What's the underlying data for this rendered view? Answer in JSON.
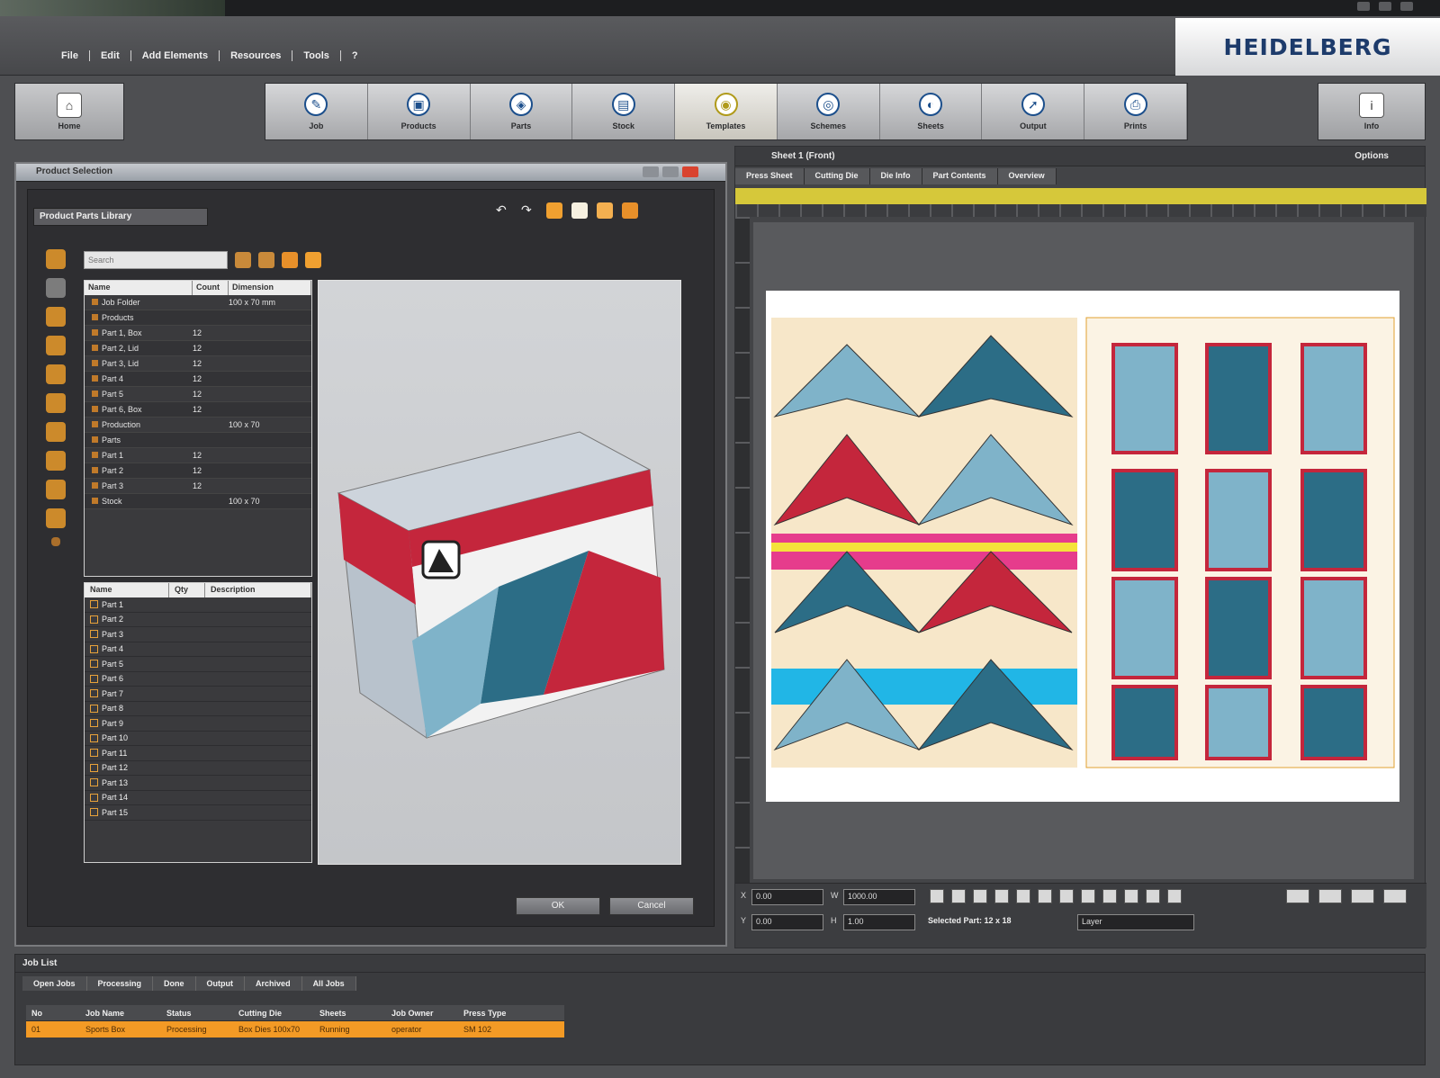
{
  "brand": {
    "logo_text": "HEIDELBERG"
  },
  "menu": {
    "items": [
      "File",
      "Edit",
      "Add Elements",
      "Resources",
      "Tools",
      "?"
    ]
  },
  "toolbar": {
    "home_label": "Home",
    "right_label": "Info",
    "steps": [
      {
        "label": "Job",
        "icon": "job-icon"
      },
      {
        "label": "Products",
        "icon": "products-icon"
      },
      {
        "label": "Parts",
        "icon": "parts-icon"
      },
      {
        "label": "Stock",
        "icon": "stock-icon"
      },
      {
        "label": "Templates",
        "icon": "templates-icon"
      },
      {
        "label": "Schemes",
        "icon": "schemes-icon"
      },
      {
        "label": "Sheets",
        "icon": "sheets-icon"
      },
      {
        "label": "Output",
        "icon": "output-icon"
      },
      {
        "label": "Prints",
        "icon": "prints-icon"
      }
    ]
  },
  "dialog": {
    "title": "Product Selection",
    "tab_label": "Product Parts Library",
    "search_placeholder": "Search",
    "tree_headers": [
      "Name",
      "Count",
      "Dimension"
    ],
    "tree_rows": [
      {
        "name": "Job Folder",
        "count": "",
        "dim": "100 x 70 mm"
      },
      {
        "name": "Products",
        "count": "",
        "dim": ""
      },
      {
        "name": "Part 1, Box",
        "count": "12",
        "dim": ""
      },
      {
        "name": "Part 2, Lid",
        "count": "12",
        "dim": ""
      },
      {
        "name": "Part 3, Lid",
        "count": "12",
        "dim": ""
      },
      {
        "name": "Part 4",
        "count": "12",
        "dim": ""
      },
      {
        "name": "Part 5",
        "count": "12",
        "dim": ""
      },
      {
        "name": "Part 6, Box",
        "count": "12",
        "dim": ""
      },
      {
        "name": "Production",
        "count": "",
        "dim": "100 x 70"
      },
      {
        "name": "Parts",
        "count": "",
        "dim": ""
      },
      {
        "name": "Part 1",
        "count": "12",
        "dim": ""
      },
      {
        "name": "Part 2",
        "count": "12",
        "dim": ""
      },
      {
        "name": "Part 3",
        "count": "12",
        "dim": ""
      },
      {
        "name": "Stock",
        "count": "",
        "dim": "100 x 70"
      }
    ],
    "list_headers": [
      "Name",
      "Qty",
      "Description"
    ],
    "list_rows": [
      "Part 1",
      "Part 2",
      "Part 3",
      "Part 4",
      "Part 5",
      "Part 6",
      "Part 7",
      "Part 8",
      "Part 9",
      "Part 10",
      "Part 11",
      "Part 12",
      "Part 13",
      "Part 14",
      "Part 15"
    ],
    "ok_label": "OK",
    "cancel_label": "Cancel"
  },
  "editor": {
    "header_left": "Sheet 1 (Front)",
    "header_right": "Options",
    "tabs": [
      "Press Sheet",
      "Cutting Die",
      "Die Info",
      "Part Contents",
      "Overview"
    ],
    "field_x_label": "X",
    "field_x_value": "0.00",
    "field_y_label": "Y",
    "field_y_value": "0.00",
    "field_w_value": "1000.00",
    "field_h_value": "1.00",
    "status_text": "Selected Part: 12 x 18",
    "layer_value": "Layer"
  },
  "jobs": {
    "title": "Job List",
    "tabs": [
      "Open Jobs",
      "Processing",
      "Done",
      "Output",
      "Archived",
      "All Jobs"
    ],
    "headers": [
      "No",
      "Job Name",
      "Status",
      "Cutting Die",
      "Sheets",
      "Job Owner",
      "Press Type"
    ],
    "row": [
      "01",
      "Sports Box",
      "Processing",
      "Box Dies 100x70",
      "Running",
      "operator",
      "SM 102"
    ]
  },
  "colors": {
    "accent_orange": "#f39a25",
    "ruler_yellow": "#d6c83a",
    "brand_blue": "#1d3b6b"
  }
}
